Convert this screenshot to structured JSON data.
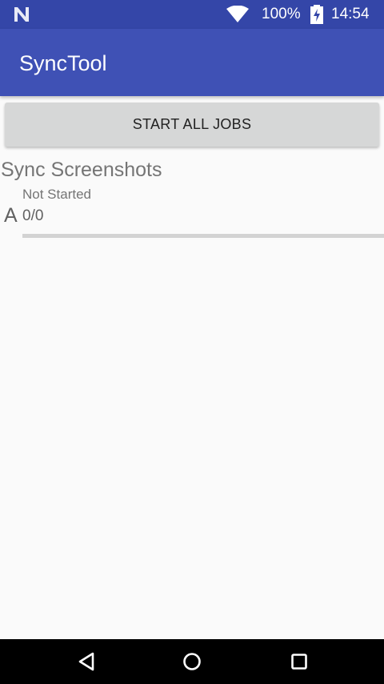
{
  "status_bar": {
    "battery_percent": "100%",
    "time": "14:54",
    "icons": [
      "notification-n-icon",
      "wifi-icon",
      "battery-charging-icon"
    ]
  },
  "app_bar": {
    "title": "SyncTool",
    "color": "#3f51b5",
    "status_bar_color": "#3446a8"
  },
  "actions": {
    "start_all_label": "START ALL JOBS"
  },
  "jobs": [
    {
      "title": "Sync Screenshots",
      "letter": "A",
      "status": "Not Started",
      "count": "0/0",
      "progress": 0
    }
  ],
  "nav_bar": {
    "icons": [
      "back-icon",
      "home-icon",
      "recents-icon"
    ]
  }
}
